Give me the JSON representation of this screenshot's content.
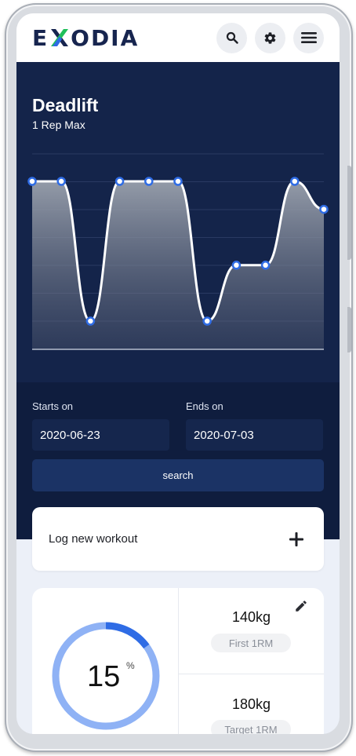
{
  "header": {
    "logo_text_left": "E",
    "logo_text_right": "ODIA",
    "icons": [
      "search-icon",
      "gear-icon",
      "menu-icon"
    ]
  },
  "chart_header": {
    "title": "Deadlift",
    "subtitle": "1 Rep Max"
  },
  "chart_data": {
    "type": "area",
    "title": "Deadlift",
    "subtitle": "1 Rep Max",
    "values": [
      5,
      5,
      0,
      5,
      5,
      5,
      0,
      2,
      2,
      5,
      4
    ],
    "ylim": [
      0,
      6
    ],
    "grid": true,
    "legend": "none",
    "point_color": "#ffffff",
    "point_stroke": "#2f6ce5",
    "line_color": "#ffffff"
  },
  "filters": {
    "starts_label": "Starts on",
    "starts_value": "2020-06-23",
    "ends_label": "Ends on",
    "ends_value": "2020-07-03",
    "search_label": "search"
  },
  "log_card": {
    "label": "Log new workout",
    "icon": "plus-icon"
  },
  "stats": {
    "progress_value": "15",
    "progress_unit": "%",
    "progress_fraction": 0.15,
    "first_value": "140kg",
    "first_label": "First 1RM",
    "target_value": "180kg",
    "target_label": "Target 1RM",
    "edit_icon": "pencil-icon"
  },
  "colors": {
    "brand_navy": "#17254f",
    "brand_green": "#1fbf5a",
    "brand_blue": "#2f6ce5",
    "ring_track": "#8fb2f5",
    "ring_fill": "#2f6ce5"
  }
}
